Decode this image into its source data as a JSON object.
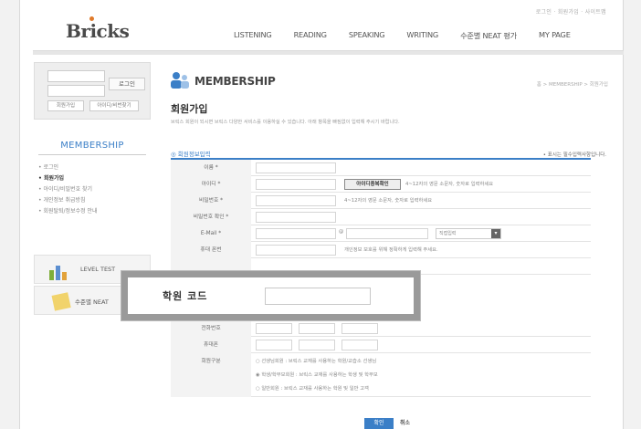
{
  "header": {
    "util_links": "로그인 · 회원가입 · 사이트맵",
    "logo": "Bricks",
    "nav": [
      "LISTENING",
      "READING",
      "SPEAKING",
      "WRITING",
      "수준별 NEAT 평가",
      "MY PAGE"
    ]
  },
  "login": {
    "login_button": "로그인",
    "join_button": "회원가입",
    "find_button": "아이디/비번찾기"
  },
  "sidebar": {
    "title": "MEMBERSHIP",
    "items": [
      {
        "label": "로그인",
        "active": false
      },
      {
        "label": "회원가입",
        "active": true
      },
      {
        "label": "아이디/비밀번호 찾기",
        "active": false
      },
      {
        "label": "개인정보 취급방침",
        "active": false
      },
      {
        "label": "회원탈퇴/정보수정 안내",
        "active": false
      }
    ],
    "banners": [
      "LEVEL TEST",
      "수준별 NEAT"
    ]
  },
  "main": {
    "section_title": "MEMBERSHIP",
    "breadcrumb": "홈 > MEMBERSHIP > 회원가입",
    "page_title": "회원가입",
    "intro": "브릭스 회원이 되시면 브릭스 다양한 서비스를 이용하실 수 있습니다. 아래 항목을 빠짐없이 입력해 주시기 바랍니다.",
    "form_header": "회원정보입력",
    "required_note": "표시는 필수입력사항입니다.",
    "rows": [
      {
        "label": "이름 *"
      },
      {
        "label": "아이디 *",
        "button": "아이디중복확인",
        "hint": "4~12자의 영문 소문자, 숫자로 입력하세요"
      },
      {
        "label": "비밀번호 *",
        "hint": "4~12자의 영문 소문자, 숫자로 입력하세요"
      },
      {
        "label": "비밀번호 확인 *"
      },
      {
        "label": "E-Mail *",
        "at": "@",
        "select": "직접입력"
      },
      {
        "label": "휴대 폰번",
        "hint": "개인정보 보호를 위해 정확하게 입력해 주세요."
      },
      {
        "label": "전화번호"
      },
      {
        "label": "휴대폰"
      },
      {
        "label": "회원구분"
      }
    ],
    "radio_options": [
      "선생님회원 : 브릭스 교재를 사용하는 학원/교습소 선생님",
      "학생/학부모회원 : 브릭스 교재를 사용하는 학생 및 학부모",
      "일반회원 : 브릭스 교재를 사용하는 학원 및 일반 고객"
    ],
    "submit_button": "확인",
    "cancel_button": "취소"
  },
  "popup": {
    "label": "학원 코드",
    "input_value": ""
  }
}
